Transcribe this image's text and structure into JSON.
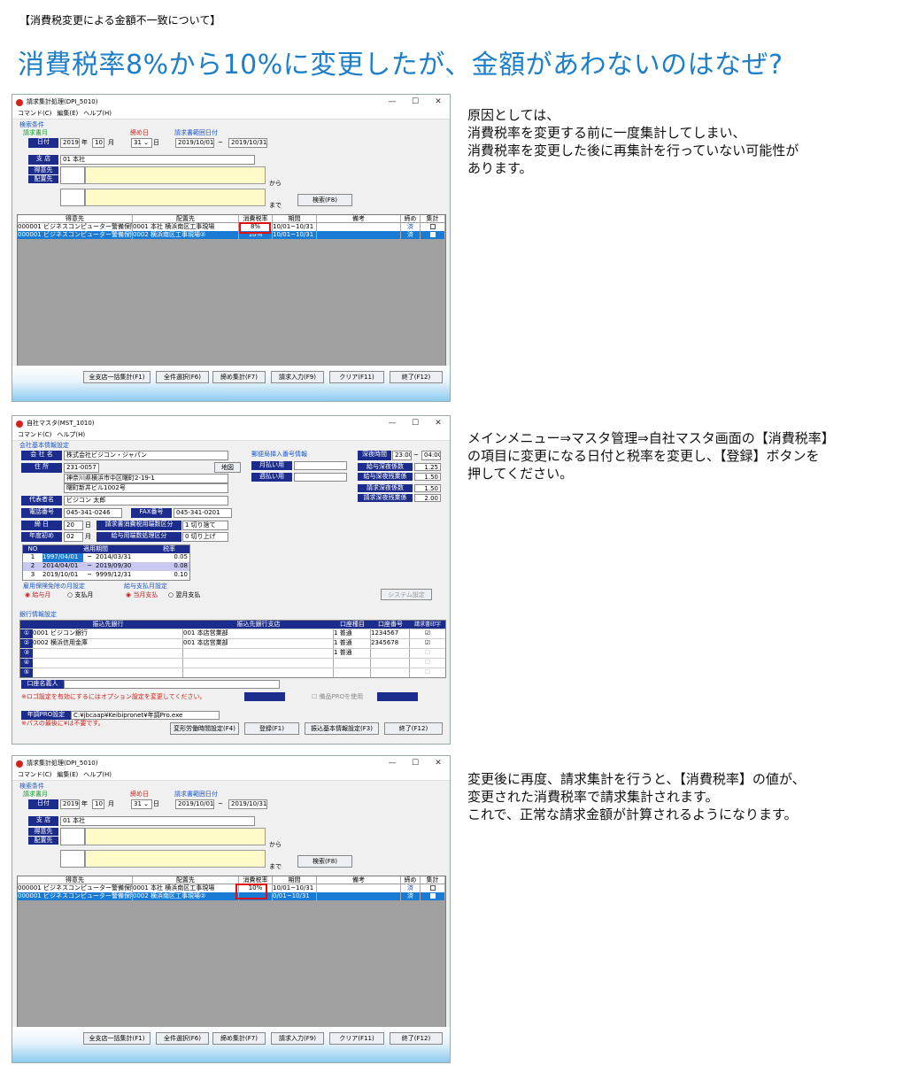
{
  "header_note": "【消費税変更による金額不一致について】",
  "page_title": "消費税率8%から10%に変更したが、金額があわないのはなぜ?",
  "explanations": [
    "原因としては、\n消費税率を変更する前に一度集計してしまい、\n消費税率を変更した後に再集計を行っていない可能性が\nあります。",
    "メインメニュー⇒マスタ管理⇒自社マスタ画面の【消費税率】\nの項目に変更になる日付と税率を変更し、【登録】ボタンを\n押してください。",
    "変更後に再度、請求集計を行うと、【消費税率】の値が、\n変更された消費税率で請求集計されます。\nこれで、正常な請求金額が計算されるようになります。"
  ],
  "billing_window": {
    "title": "請求集計処理(DPI_5010)",
    "menu": [
      "コマンド(C)",
      "編集(E)",
      "ヘルプ(H)"
    ],
    "search_group": "検索条件",
    "billing_month_label": "請求書月",
    "date_label": "日付",
    "year": "2019",
    "year_unit": "年",
    "month": "10",
    "month_unit": "月",
    "closing_label": "締め日",
    "closing_day": "31",
    "day_unit": "日",
    "range_label": "請求書範囲日付",
    "range_from": "2019/10/01",
    "range_sep": "~",
    "range_to": "2019/10/31",
    "branch_label": "支 店",
    "branch_value": "01 本社",
    "customer_label": "得意先",
    "deliver_label": "配置先",
    "from_label": "から",
    "to_label": "まで",
    "search_button": "検索(F8)",
    "columns": [
      "得意先",
      "配置先",
      "消費税率",
      "期間",
      "備考",
      "締め",
      "集計"
    ],
    "buttons": [
      "全支店一括集計(F1)",
      "全件選択(F6)",
      "締め集計(F7)",
      "請求入力(F9)",
      "クリア(F11)",
      "終了(F12)"
    ]
  },
  "window1_rows": [
    {
      "customer": "000001 ビジネスコンピューター警備保障",
      "deliver": "0001 本社 横浜南区工事現場",
      "tax": "8%",
      "period": "10/01~10/31",
      "close": "済",
      "selected": false
    },
    {
      "customer": "000001 ビジネスコンピューター警備保障",
      "deliver": "0002 横浜南区工事現場②",
      "tax": "10%",
      "period": "10/01~10/31",
      "close": "済",
      "selected": true
    }
  ],
  "window3_rows": [
    {
      "customer": "000001 ビジネスコンピューター警備保障",
      "deliver": "0001 本社 横浜南区工事現場",
      "tax": "10%",
      "period": "10/01~10/31",
      "close": "済",
      "selected": false
    },
    {
      "customer": "000001 ビジネスコンピューター警備保障",
      "deliver": "0002 横浜南区工事現場②",
      "tax": "",
      "period": "0/01~10/31",
      "close": "済",
      "selected": true
    }
  ],
  "company_window": {
    "title": "自社マスタ(MST_1010)",
    "menu": [
      "コマンド(C)",
      "ヘルプ(H)"
    ],
    "basic_group": "会社基本情報設定",
    "company_name_label": "会 社 名",
    "company_name": "株式会社ビジコン・ジャパン",
    "address_label": "住 所",
    "zip": "231-0057",
    "address1": "神奈川県横浜市中区曙町2-19-1",
    "address2": "曙町新井ビル1002号",
    "map_button": "地図",
    "rep_label": "代表者名",
    "rep": "ビジコン 太郎",
    "tel_label": "電話番号",
    "tel": "045-341-0246",
    "fax_label": "FAX番号",
    "fax": "045-341-0201",
    "closing_label": "締 日",
    "closing": "20",
    "closing_unit": "日",
    "tax_round_label": "請求書消費税用端数区分",
    "tax_round": "1 切り捨て",
    "year_start_label": "年度初め",
    "year_start": "02",
    "year_start_unit": "月",
    "pay_round_label": "給与用端数処理区分",
    "pay_round": "0 切り上げ",
    "tax_table_headers": [
      "NO",
      "適用期間",
      "税率"
    ],
    "tax_rows": [
      {
        "no": "1",
        "from": "1997/04/01",
        "sep": "~",
        "to": "2014/03/31",
        "rate": "0.05"
      },
      {
        "no": "2",
        "from": "2014/04/01",
        "sep": "~",
        "to": "2019/09/30",
        "rate": "0.08"
      },
      {
        "no": "3",
        "from": "2019/10/01",
        "sep": "~",
        "to": "9999/12/31",
        "rate": "0.10"
      }
    ],
    "postal_group": "郵便局挿入番号情報",
    "payout_label": "月払い用",
    "weekly_label": "週払い用",
    "night_label": "深夜時間",
    "night_from": "23:00",
    "night_sep": "~",
    "night_to": "04:00",
    "rates": [
      {
        "label": "給与深夜係数",
        "value": "1.25"
      },
      {
        "label": "給与深夜残業係",
        "value": "1.50"
      },
      {
        "label": "請求深夜係数",
        "value": "1.50"
      },
      {
        "label": "請求深夜残業係",
        "value": "2.00"
      }
    ],
    "insurance_label": "雇用保険免除の月設定",
    "ins_opt1": "給与月",
    "ins_opt2": "支払月",
    "pay_month_label": "給与支払月設定",
    "pay_opt1": "当月支払",
    "pay_opt2": "翌月支払",
    "system_button": "システム設定",
    "bank_group": "銀行情報設定",
    "bank_headers": [
      "振込先銀行",
      "振込先銀行支店",
      "口座種目",
      "口座番号",
      "請求書印字"
    ],
    "bank_rows": [
      {
        "no": "①",
        "bank": "0001 ビジコン銀行",
        "branch": "001 本店営業部",
        "kind": "1 普通",
        "number": "1234567",
        "checked": true
      },
      {
        "no": "②",
        "bank": "0002 横浜信用金庫",
        "branch": "001 本店営業部",
        "kind": "1 普通",
        "number": "2345678",
        "checked": true
      },
      {
        "no": "③",
        "bank": "",
        "branch": "",
        "kind": "1 普通",
        "number": "",
        "checked": false
      },
      {
        "no": "④",
        "bank": "",
        "branch": "",
        "kind": "",
        "number": "",
        "checked": false
      },
      {
        "no": "⑤",
        "bank": "",
        "branch": "",
        "kind": "",
        "number": "",
        "checked": false
      }
    ],
    "holder_label": "口座名義人",
    "logo_note": "※ロゴ設定を有効にするにはオプション設定を変更してください。",
    "equip_label": "備品PROを使用",
    "nenchou_label": "年調PRO設定",
    "nenchou_path": "C:¥jbcaap¥Keibipronet¥年調Pro.exe",
    "path_note": "※パスの最後に¥は不要です。",
    "buttons": [
      "変形労働時間設定(F4)",
      "登録(F1)",
      "振込基本情報設定(F3)",
      "終了(F12)"
    ]
  }
}
